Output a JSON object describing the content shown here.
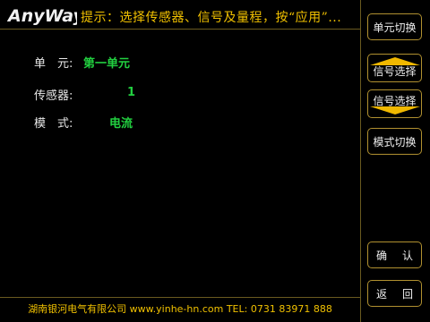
{
  "header": {
    "logo": "AnyWay",
    "hint": "提示：选择传感器、信号及量程，按“应用”..."
  },
  "fields": [
    {
      "label": "单　元:",
      "value": "第一单元"
    },
    {
      "label": "传感器:",
      "value": "1"
    },
    {
      "label": "模　式:",
      "value": "电流"
    }
  ],
  "buttons": {
    "unit_switch": "单元切换",
    "signal_select_up": "信号选择",
    "signal_select_down": "信号选择",
    "mode_switch": "模式切换",
    "confirm": [
      "确",
      "认"
    ],
    "back": [
      "返",
      "回"
    ]
  },
  "footer": "湖南银河电气有限公司 www.yinhe-hn.com TEL: 0731 83971 888",
  "colors": {
    "background": "#000000",
    "accent": "#f0c000",
    "value": "#22d040",
    "border": "#b09030"
  }
}
